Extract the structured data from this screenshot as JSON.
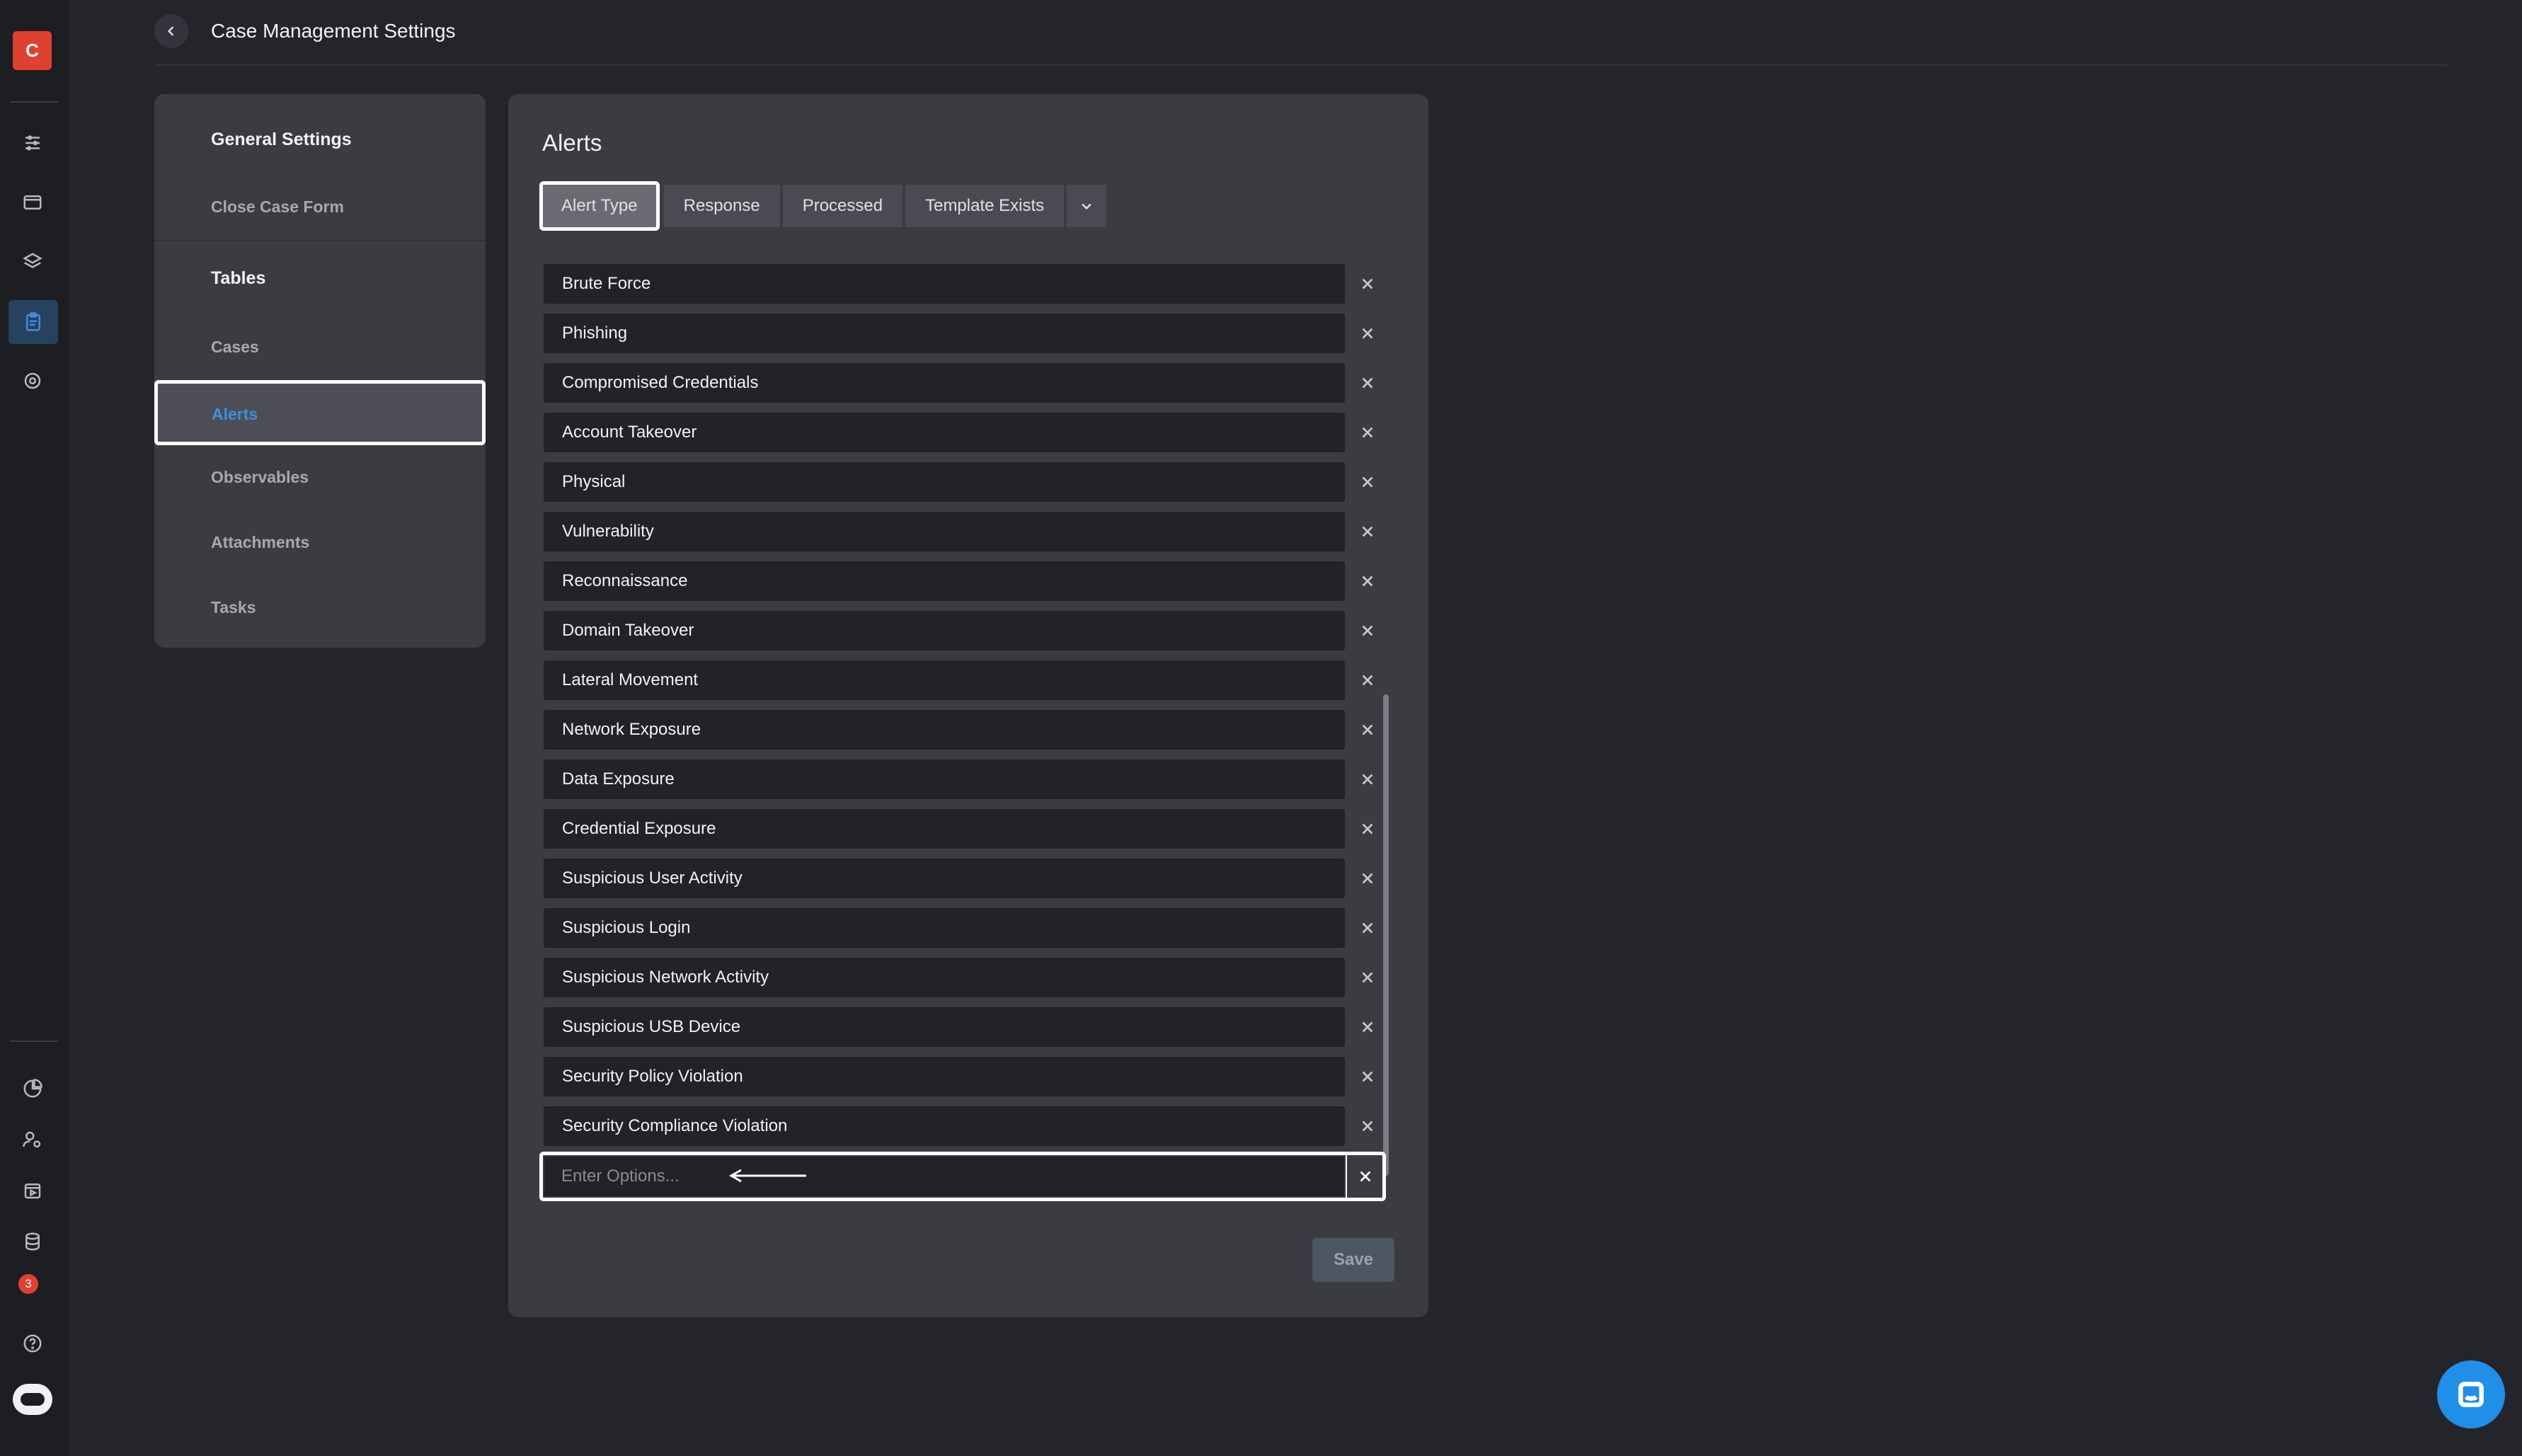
{
  "header": {
    "title": "Case Management Settings",
    "back_icon": "chevron-left-icon"
  },
  "rail": {
    "logo_letter": "C",
    "notification_count": "3",
    "icons": [
      "sliders-icon",
      "browser-window-icon",
      "layers-icon",
      "clipboard-icon",
      "target-icon",
      "pie-chart-icon",
      "user-settings-icon",
      "play-calendar-icon",
      "database-icon",
      "notification-icon",
      "help-icon",
      "assistant-icon"
    ]
  },
  "nav": {
    "general_heading": "General Settings",
    "close_case_form": "Close Case Form",
    "tables_heading": "Tables",
    "cases": "Cases",
    "alerts": "Alerts",
    "observables": "Observables",
    "attachments": "Attachments",
    "tasks": "Tasks"
  },
  "panel": {
    "title": "Alerts",
    "tabs": [
      "Alert Type",
      "Response",
      "Processed",
      "Template Exists"
    ],
    "active_tab": "Alert Type",
    "options": [
      "Brute Force",
      "Phishing",
      "Compromised Credentials",
      "Account Takeover",
      "Physical",
      "Vulnerability",
      "Reconnaissance",
      "Domain Takeover",
      "Lateral Movement",
      "Network Exposure",
      "Data Exposure",
      "Credential Exposure",
      "Suspicious User Activity",
      "Suspicious Login",
      "Suspicious Network Activity",
      "Suspicious USB Device",
      "Security Policy Violation",
      "Security Compliance Violation"
    ],
    "new_option_placeholder": "Enter Options...",
    "new_option_value": "",
    "save_label": "Save"
  },
  "colors": {
    "background": "#24252b",
    "card": "#3b3c42",
    "accent_blue": "#3d8fe0",
    "logo_red": "#e0402f",
    "chat_blue": "#1f8fe8"
  }
}
